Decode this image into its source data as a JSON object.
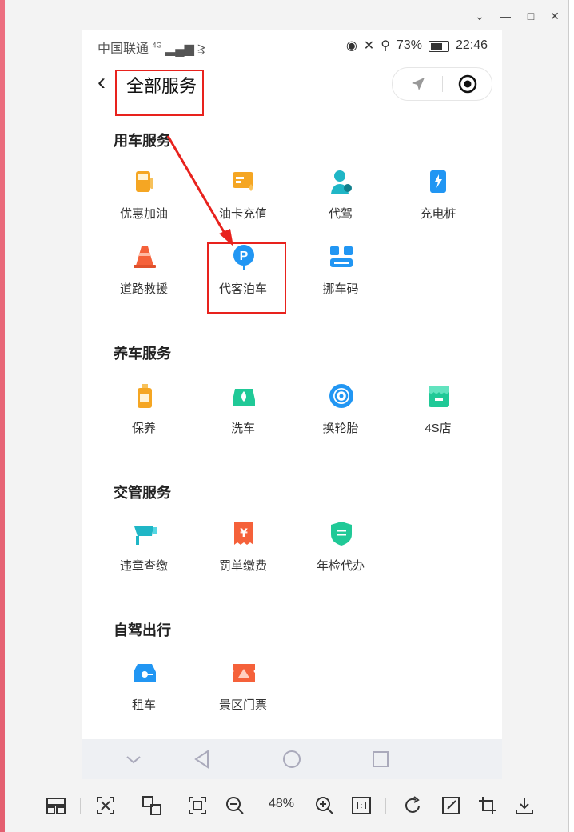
{
  "status_bar": {
    "carrier": "中国联通",
    "network": "4G",
    "battery": "73%",
    "time": "22:46"
  },
  "header": {
    "title": "全部服务"
  },
  "sections": [
    {
      "title": "用车服务",
      "items": [
        {
          "label": "优惠加油",
          "icon": "fuel-pump-icon"
        },
        {
          "label": "油卡充值",
          "icon": "fuel-card-icon"
        },
        {
          "label": "代驾",
          "icon": "driver-icon"
        },
        {
          "label": "充电桩",
          "icon": "charging-pile-icon"
        },
        {
          "label": "道路救援",
          "icon": "traffic-cone-icon"
        },
        {
          "label": "代客泊车",
          "icon": "parking-icon"
        },
        {
          "label": "挪车码",
          "icon": "move-car-code-icon"
        }
      ]
    },
    {
      "title": "养车服务",
      "items": [
        {
          "label": "保养",
          "icon": "oil-bottle-icon"
        },
        {
          "label": "洗车",
          "icon": "car-wash-icon"
        },
        {
          "label": "换轮胎",
          "icon": "tire-icon"
        },
        {
          "label": "4S店",
          "icon": "store-icon"
        }
      ]
    },
    {
      "title": "交管服务",
      "items": [
        {
          "label": "违章查缴",
          "icon": "camera-icon"
        },
        {
          "label": "罚单缴费",
          "icon": "ticket-yuan-icon"
        },
        {
          "label": "年检代办",
          "icon": "inspection-icon"
        }
      ]
    },
    {
      "title": "自驾出行",
      "items": [
        {
          "label": "租车",
          "icon": "rental-car-icon"
        },
        {
          "label": "景区门票",
          "icon": "scenic-ticket-icon"
        }
      ]
    }
  ],
  "toolbar": {
    "zoom": "48%"
  },
  "colors": {
    "highlight_red": "#e8221d",
    "orange": "#f5a623",
    "blue": "#2196f3",
    "teal": "#20c997"
  }
}
